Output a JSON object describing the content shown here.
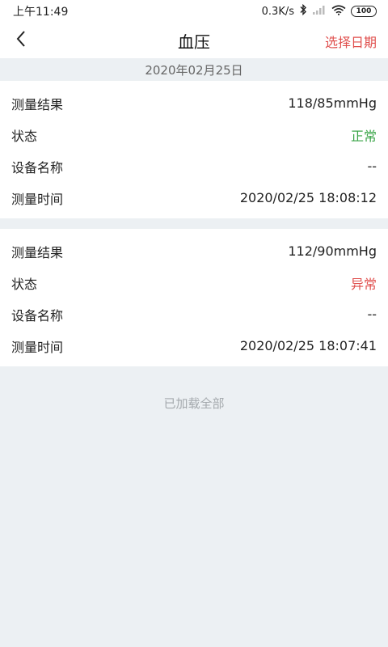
{
  "status_bar": {
    "time": "上午11:49",
    "network_speed": "0.3K/s",
    "battery": "100",
    "icons": [
      "bluetooth-icon",
      "signal-icon",
      "wifi-icon",
      "battery-icon"
    ]
  },
  "header": {
    "title": "血压",
    "select_date": "选择日期",
    "back_icon": "chevron-left-icon"
  },
  "date": "2020年02月25日",
  "records": [
    {
      "result_label": "测量结果",
      "result_value": "118/85mmHg",
      "status_label": "状态",
      "status_value": "正常",
      "device_label": "设备名称",
      "device_value": "--",
      "time_label": "测量时间",
      "time_value": "2020/02/25 18:08:12"
    },
    {
      "result_label": "测量结果",
      "result_value": "112/90mmHg",
      "status_label": "状态",
      "status_value": "异常",
      "device_label": "设备名称",
      "device_value": "--",
      "time_label": "测量时间",
      "time_value": "2020/02/25 18:07:41"
    }
  ],
  "loaded_all": "已加载全部",
  "colors": {
    "accent": "#e0504e",
    "normal": "#3ba548",
    "background": "#ecf0f3"
  }
}
